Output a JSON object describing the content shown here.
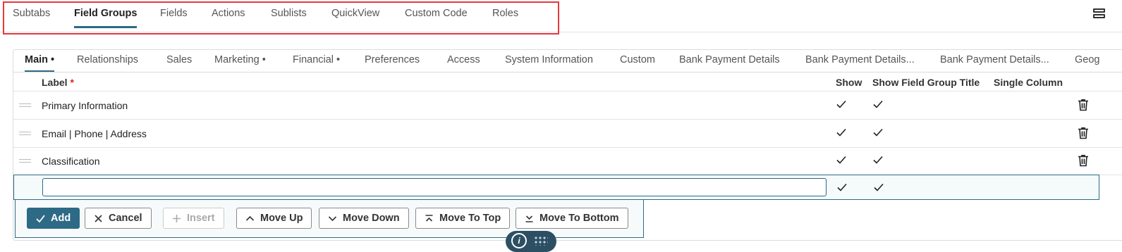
{
  "top_tabs": [
    {
      "label": "Subtabs",
      "active": false
    },
    {
      "label": "Field Groups",
      "active": true
    },
    {
      "label": "Fields",
      "active": false
    },
    {
      "label": "Actions",
      "active": false
    },
    {
      "label": "Sublists",
      "active": false
    },
    {
      "label": "QuickView",
      "active": false
    },
    {
      "label": "Custom Code",
      "active": false
    },
    {
      "label": "Roles",
      "active": false
    }
  ],
  "sub_tabs": [
    {
      "label": "Main •",
      "active": true
    },
    {
      "label": "Relationships"
    },
    {
      "label": "Sales"
    },
    {
      "label": "Marketing •"
    },
    {
      "label": "Financial •"
    },
    {
      "label": "Preferences"
    },
    {
      "label": "Access"
    },
    {
      "label": "System Information"
    },
    {
      "label": "Custom"
    },
    {
      "label": "Bank Payment Details"
    },
    {
      "label": "Bank Payment Details..."
    },
    {
      "label": "Bank Payment Details..."
    },
    {
      "label": "Geog"
    }
  ],
  "table": {
    "headers": {
      "label": "Label",
      "required_mark": "*",
      "show": "Show",
      "show_title": "Show Field Group Title",
      "single_column": "Single Column"
    },
    "rows": [
      {
        "label": "Primary Information",
        "show": true,
        "show_title": true,
        "single_column": false
      },
      {
        "label": "Email | Phone | Address",
        "show": true,
        "show_title": true,
        "single_column": false
      },
      {
        "label": "Classification",
        "show": true,
        "show_title": true,
        "single_column": false
      }
    ],
    "new_row": {
      "value": "",
      "show": true,
      "show_title": true
    }
  },
  "buttons": {
    "add": "Add",
    "cancel": "Cancel",
    "insert": "Insert",
    "move_up": "Move Up",
    "move_down": "Move Down",
    "move_to_top": "Move To Top",
    "move_to_bottom": "Move To Bottom"
  },
  "info_pill": {
    "icon": "info-icon",
    "letter": "i"
  },
  "colors": {
    "accent": "#2d6a86",
    "highlight_frame": "#e5393d",
    "required": "#d9281f"
  }
}
